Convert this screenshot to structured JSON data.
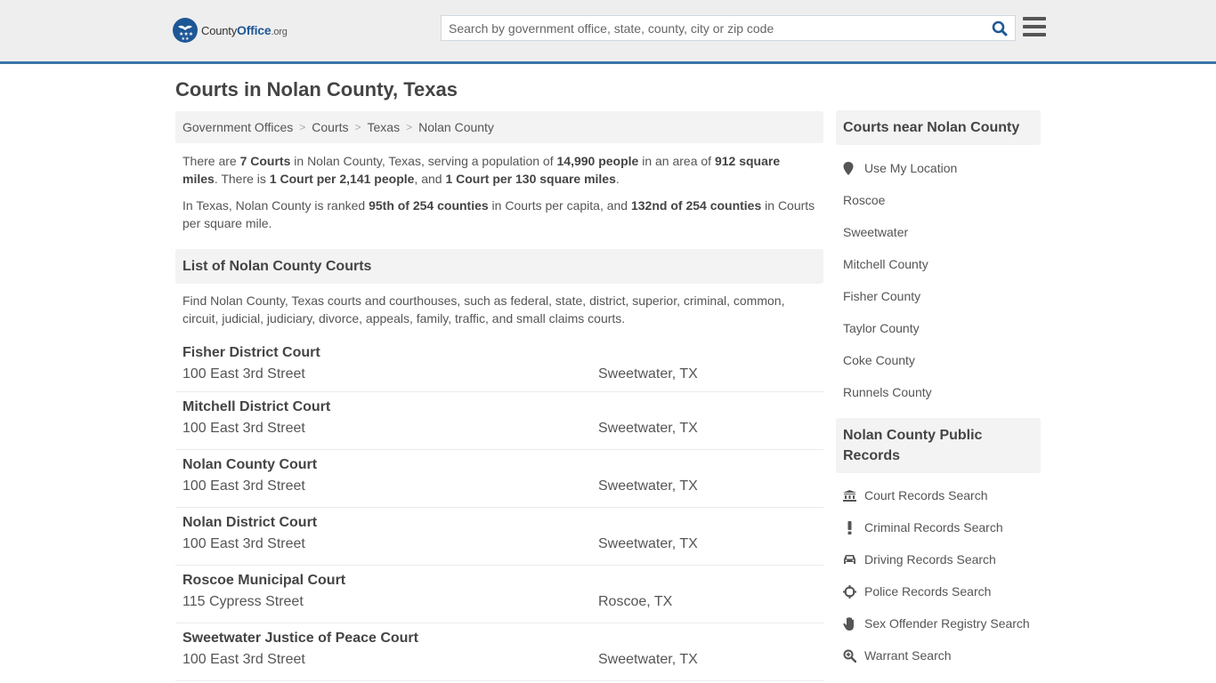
{
  "header": {
    "logo": {
      "pre": "County",
      "bold": "Office",
      "suffix": ".org"
    },
    "search_placeholder": "Search by government office, state, county, city or zip code",
    "colors": {
      "accent": "#3a75a8",
      "brand": "#1e5796"
    }
  },
  "page": {
    "title": "Courts in Nolan County, Texas",
    "breadcrumb": [
      "Government Offices",
      "Courts",
      "Texas",
      "Nolan County"
    ],
    "summary": {
      "t1": "There are ",
      "b1": "7 Courts",
      "t2": " in Nolan County, Texas, serving a population of ",
      "b2": "14,990 people",
      "t3": " in an area of ",
      "b3": "912 square miles",
      "t4": ". There is ",
      "b4": "1 Court per 2,141 people",
      "t5": ", and ",
      "b5": "1 Court per 130 square miles",
      "t6": "."
    },
    "ranking": {
      "t1": "In Texas, Nolan County is ranked ",
      "b1": "95th of 254 counties",
      "t2": " in Courts per capita, and ",
      "b2": "132nd of 254 counties",
      "t3": " in Courts per square mile."
    },
    "list_heading": "List of Nolan County Courts",
    "list_description": "Find Nolan County, Texas courts and courthouses, such as federal, state, district, superior, criminal, common, circuit, judicial, judiciary, divorce, appeals, family, traffic, and small claims courts.",
    "courts": [
      {
        "name": "Fisher District Court",
        "address": "100 East 3rd Street",
        "city": "Sweetwater, TX"
      },
      {
        "name": "Mitchell District Court",
        "address": "100 East 3rd Street",
        "city": "Sweetwater, TX"
      },
      {
        "name": "Nolan County Court",
        "address": "100 East 3rd Street",
        "city": "Sweetwater, TX"
      },
      {
        "name": "Nolan District Court",
        "address": "100 East 3rd Street",
        "city": "Sweetwater, TX"
      },
      {
        "name": "Roscoe Municipal Court",
        "address": "115 Cypress Street",
        "city": "Roscoe, TX"
      },
      {
        "name": "Sweetwater Justice of Peace Court",
        "address": "100 East 3rd Street",
        "city": "Sweetwater, TX"
      }
    ]
  },
  "sidebar": {
    "nearby_heading": "Courts near Nolan County",
    "use_location": {
      "label": "Use My Location",
      "icon": "map-marker-icon"
    },
    "nearby": [
      "Roscoe",
      "Sweetwater",
      "Mitchell County",
      "Fisher County",
      "Taylor County",
      "Coke County",
      "Runnels County"
    ],
    "records_heading": "Nolan County Public Records",
    "records": [
      {
        "label": "Court Records Search",
        "icon": "courthouse-icon"
      },
      {
        "label": "Criminal Records Search",
        "icon": "exclamation-icon"
      },
      {
        "label": "Driving Records Search",
        "icon": "car-icon"
      },
      {
        "label": "Police Records Search",
        "icon": "crosshairs-icon"
      },
      {
        "label": "Sex Offender Registry Search",
        "icon": "hand-icon"
      },
      {
        "label": "Warrant Search",
        "icon": "zoom-in-icon"
      }
    ]
  }
}
